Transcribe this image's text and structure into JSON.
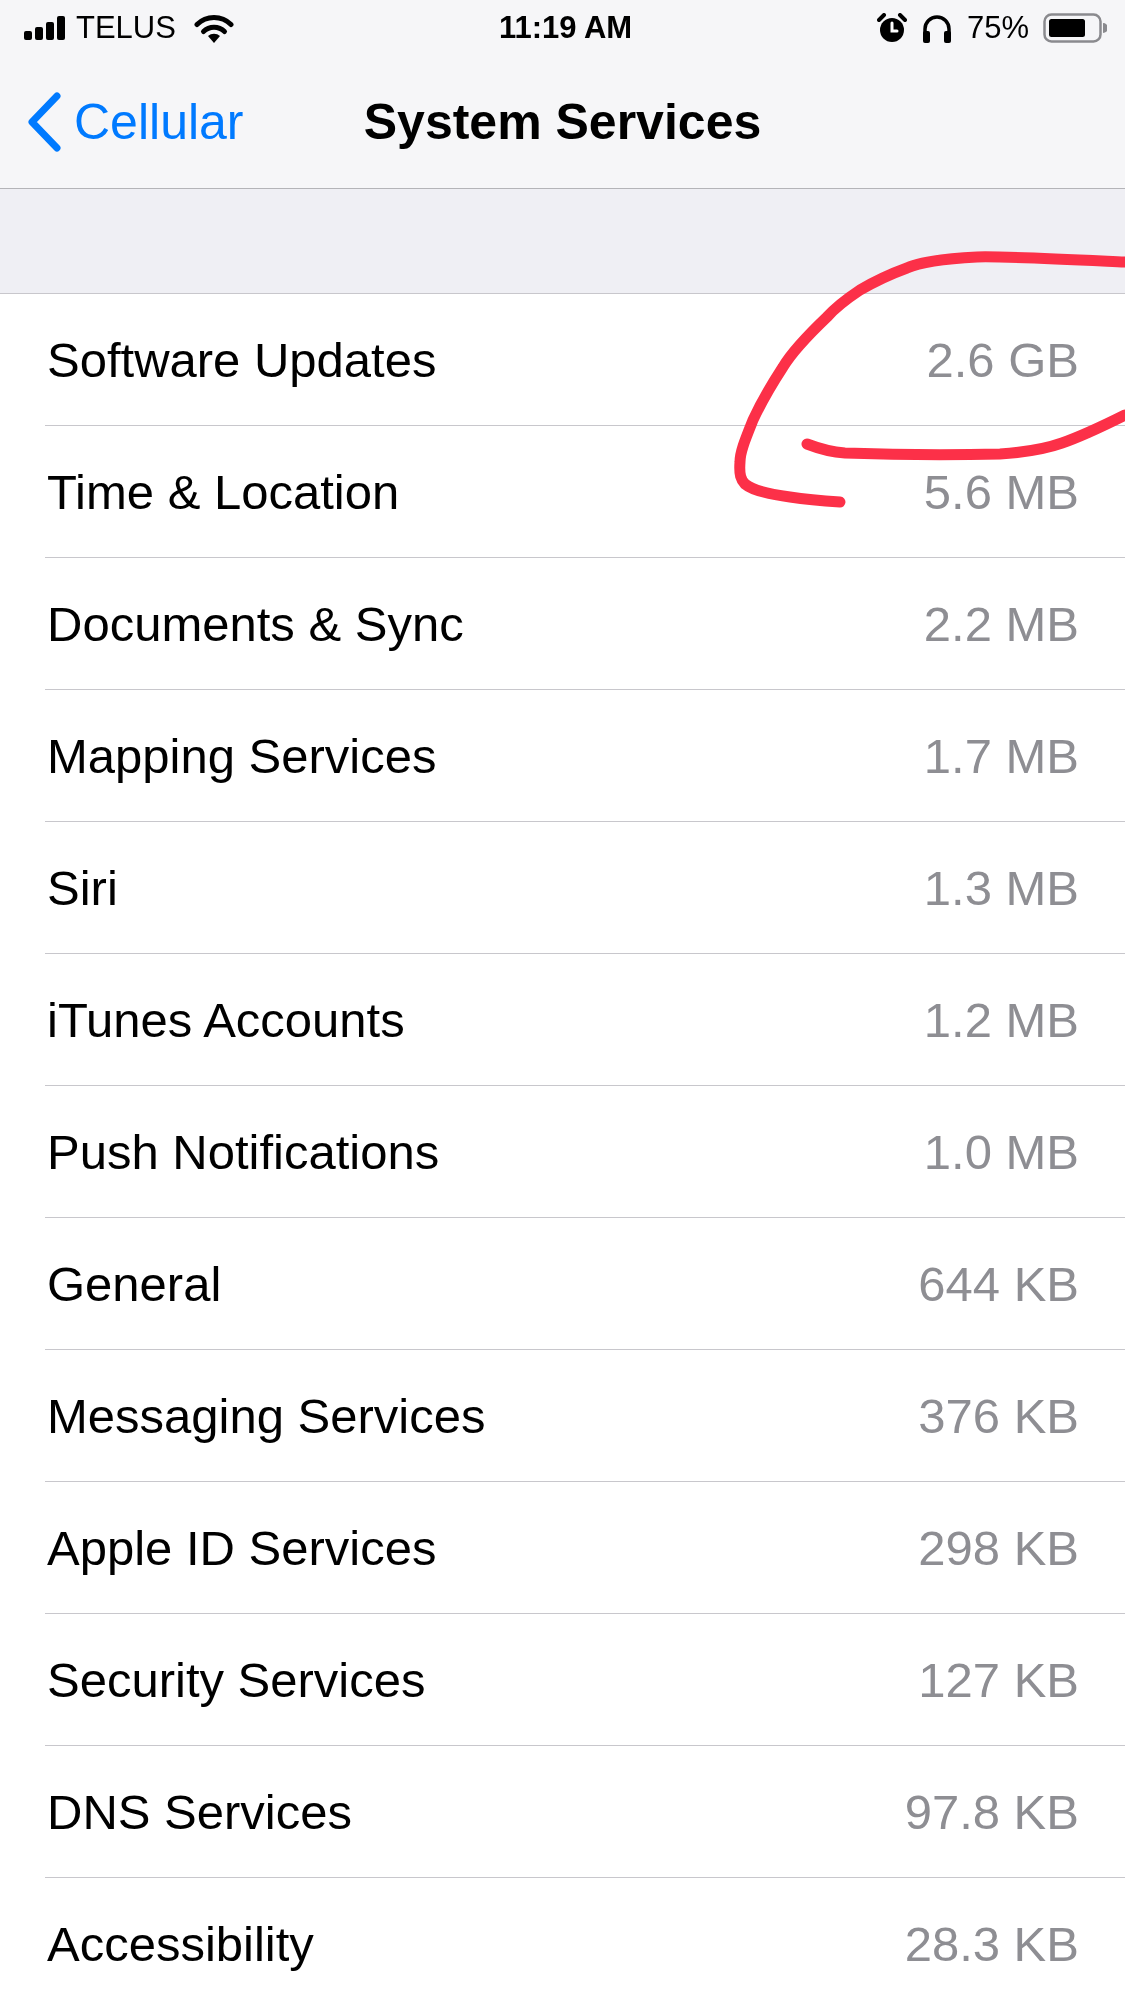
{
  "status_bar": {
    "carrier": "TELUS",
    "time": "11:19 AM",
    "battery": "75%"
  },
  "nav_bar": {
    "back": "Cellular",
    "title": "System Services"
  },
  "rows": [
    {
      "label": "Software Updates",
      "value": "2.6 GB"
    },
    {
      "label": "Time & Location",
      "value": "5.6 MB"
    },
    {
      "label": "Documents & Sync",
      "value": "2.2 MB"
    },
    {
      "label": "Mapping Services",
      "value": "1.7 MB"
    },
    {
      "label": "Siri",
      "value": "1.3 MB"
    },
    {
      "label": "iTunes Accounts",
      "value": "1.2 MB"
    },
    {
      "label": "Push Notifications",
      "value": "1.0 MB"
    },
    {
      "label": "General",
      "value": "644 KB"
    },
    {
      "label": "Messaging Services",
      "value": "376 KB"
    },
    {
      "label": "Apple ID Services",
      "value": "298 KB"
    },
    {
      "label": "Security Services",
      "value": "127 KB"
    },
    {
      "label": "DNS Services",
      "value": "97.8 KB"
    },
    {
      "label": "Accessibility",
      "value": "28.3 KB"
    }
  ],
  "annotation": {
    "kind": "freehand-loop"
  }
}
